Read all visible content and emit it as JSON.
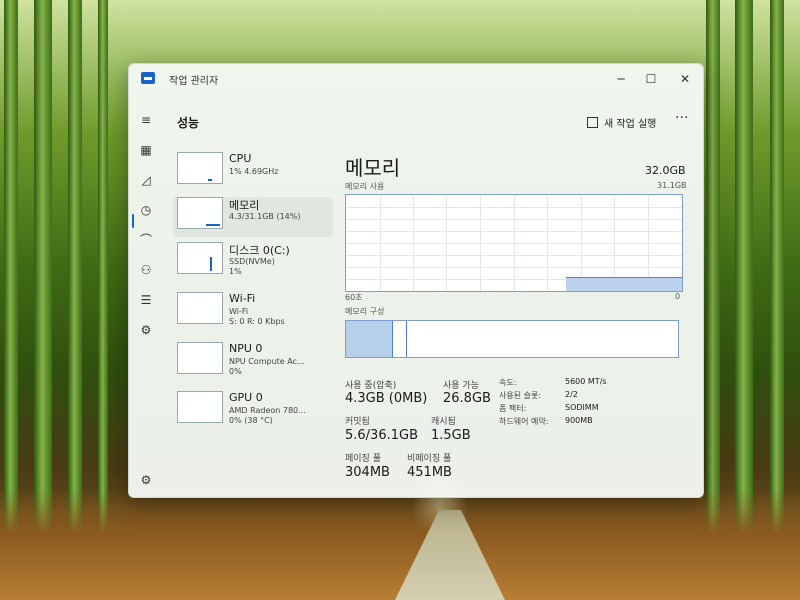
{
  "window": {
    "title": "작업 관리자"
  },
  "header": {
    "title": "성능",
    "run_task": "새 작업 실행"
  },
  "sidebar": [
    {
      "title": "CPU",
      "sub1": "1% 4.69GHz",
      "sub2": ""
    },
    {
      "title": "메모리",
      "sub1": "4.3/31.1GB (14%)",
      "sub2": ""
    },
    {
      "title": "디스크 0(C:)",
      "sub1": "SSD(NVMe)",
      "sub2": "1%"
    },
    {
      "title": "Wi-Fi",
      "sub1": "Wi-Fi",
      "sub2": "S: 0  R: 0 Kbps"
    },
    {
      "title": "NPU 0",
      "sub1": "NPU Compute Ac...",
      "sub2": "0%"
    },
    {
      "title": "GPU 0",
      "sub1": "AMD Radeon 780...",
      "sub2": "0% (38 °C)"
    }
  ],
  "memory": {
    "title": "메모리",
    "total": "32.0GB",
    "usage_label": "메모리 사용",
    "usage_max": "31.1GB",
    "time_left": "60초",
    "time_right": "0",
    "composition_label": "메모리 구성",
    "usage_fraction": 0.14,
    "stats": {
      "in_use_label": "사용 중(압축)",
      "in_use_value": "4.3GB (0MB)",
      "available_label": "사용 가능",
      "available_value": "26.8GB",
      "committed_label": "커밋됨",
      "committed_value": "5.6/36.1GB",
      "cached_label": "캐시됨",
      "cached_value": "1.5GB",
      "paged_label": "페이징 풀",
      "paged_value": "304MB",
      "nonpaged_label": "비페이징 풀",
      "nonpaged_value": "451MB"
    },
    "details": [
      {
        "label": "속도:",
        "value": "5600 MT/s"
      },
      {
        "label": "사용된 슬롯:",
        "value": "2/2"
      },
      {
        "label": "폼 팩터:",
        "value": "SODIMM"
      },
      {
        "label": "하드웨어 예약:",
        "value": "900MB"
      }
    ]
  },
  "colors": {
    "accent": "#1b63c4",
    "graph_fill": "#bcd2ee"
  },
  "icons": [
    "hamburger-icon",
    "processes-icon",
    "performance-icon",
    "history-icon",
    "startup-icon",
    "users-icon",
    "details-icon",
    "services-icon",
    "settings-icon"
  ]
}
